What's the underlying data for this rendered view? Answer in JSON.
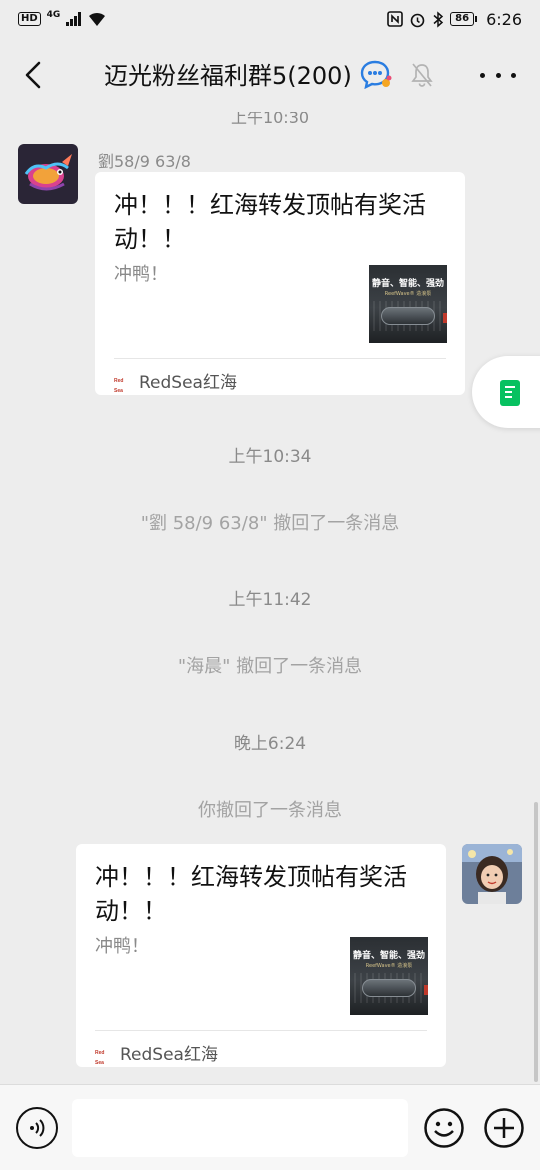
{
  "status_bar": {
    "hd": "HD",
    "network": "4G",
    "battery": "86",
    "time": "6:26",
    "icons": [
      "nfc-icon",
      "alarm-icon",
      "bluetooth-icon"
    ]
  },
  "nav": {
    "title": "迈光粉丝福利群5(200)",
    "icons": [
      "back-chevron-icon",
      "group-chat-bubble-icon",
      "muted-bell-icon",
      "more-dots-icon"
    ]
  },
  "chat": {
    "partial_timestamp": "上午10:30",
    "messages": [
      {
        "sender": "劉58/9  63/8",
        "card_title": "冲！！！红海转发顶帖有奖活动！！",
        "card_desc": "冲鸭！",
        "thumb_title": "静音、智能、强劲",
        "thumb_subtitle": "ReefWave® 造浪泵",
        "source_logo": "Red Sea",
        "source_name": "RedSea红海"
      },
      {
        "sender": "",
        "card_title": "冲！！！红海转发顶帖有奖活动！！",
        "card_desc": "冲鸭！",
        "thumb_title": "静音、智能、强劲",
        "thumb_subtitle": "ReefWave® 造浪泵",
        "source_logo": "Red Sea",
        "source_name": "RedSea红海"
      }
    ],
    "events": [
      {
        "timestamp": "上午10:34",
        "system": "\"劉 58/9  63/8\" 撤回了一条消息"
      },
      {
        "timestamp": "上午11:42",
        "system": "\"海晨\" 撤回了一条消息"
      },
      {
        "timestamp": "晚上6:24",
        "system": "你撤回了一条消息"
      }
    ]
  },
  "input_bar": {
    "value": "",
    "placeholder": "",
    "icons": [
      "voice-icon",
      "emoji-icon",
      "plus-icon"
    ]
  },
  "colors": {
    "background": "#ededed",
    "bubble": "#ffffff",
    "accent_green": "#07c160",
    "muted_text": "#8a8a8a"
  }
}
